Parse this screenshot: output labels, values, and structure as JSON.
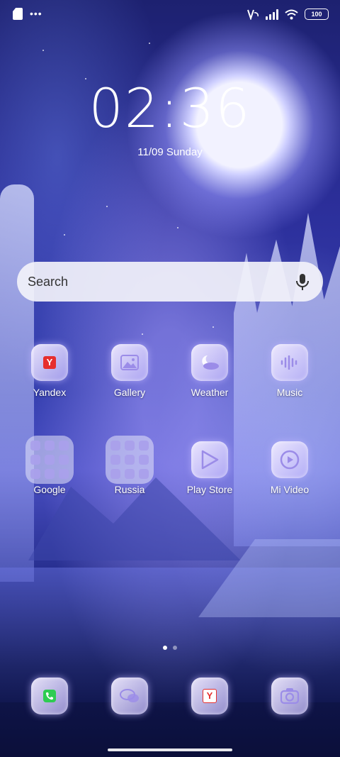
{
  "status_bar": {
    "left_icons": [
      "sim-card-icon",
      "more-dots-icon"
    ],
    "more_dots": "•••",
    "right_icons": [
      "vowifi-icon",
      "signal-icon",
      "wifi-icon"
    ],
    "battery": "100"
  },
  "clock": {
    "time": "02:36",
    "date": "11/09 Sunday"
  },
  "search": {
    "placeholder": "Search",
    "mic_icon": "microphone-icon"
  },
  "apps_row1": [
    {
      "label": "Yandex",
      "icon": "yandex-icon"
    },
    {
      "label": "Gallery",
      "icon": "gallery-icon"
    },
    {
      "label": "Weather",
      "icon": "weather-icon"
    },
    {
      "label": "Music",
      "icon": "music-icon"
    }
  ],
  "apps_row2": [
    {
      "label": "Google",
      "icon": "folder-icon"
    },
    {
      "label": "Russia",
      "icon": "folder-icon"
    },
    {
      "label": "Play Store",
      "icon": "play-store-icon"
    },
    {
      "label": "Mi Video",
      "icon": "mi-video-icon"
    }
  ],
  "dock": [
    {
      "icon": "phone-icon"
    },
    {
      "icon": "messages-icon"
    },
    {
      "icon": "yandex-browser-icon"
    },
    {
      "icon": "camera-icon"
    }
  ],
  "icon_text": {
    "yandex": "Y"
  },
  "pager": {
    "pages": 2,
    "active": 1
  },
  "colors": {
    "yandex_red": "#e62e2e",
    "phone_green": "#2ecc52",
    "icon_purple": "#9b8ce8"
  }
}
